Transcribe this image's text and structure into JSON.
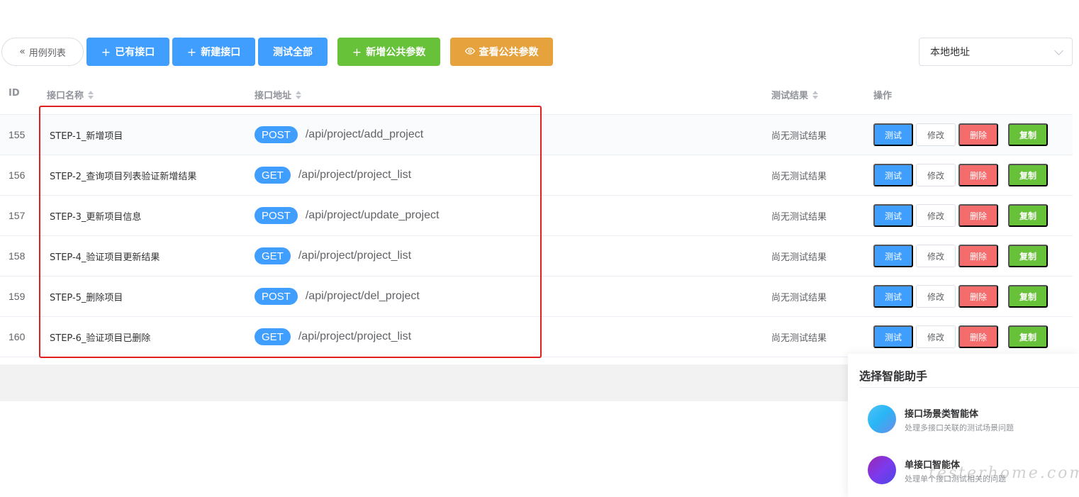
{
  "toolbar": {
    "back_label": "用例列表",
    "existing_label": "已有接口",
    "new_label": "新建接口",
    "test_all_label": "测试全部",
    "add_param_label": "新增公共参数",
    "view_param_label": "查看公共参数",
    "env_select_value": "本地地址"
  },
  "table": {
    "headers": {
      "id": "ID",
      "name": "接口名称",
      "path": "接口地址",
      "result": "测试结果",
      "ops": "操作"
    },
    "rows": [
      {
        "id": "155",
        "name": "STEP-1_新增项目",
        "method": "POST",
        "url": "/api/project/add_project",
        "result": "尚无测试结果"
      },
      {
        "id": "156",
        "name": "STEP-2_查询项目列表验证新增结果",
        "method": "GET",
        "url": "/api/project/project_list",
        "result": "尚无测试结果"
      },
      {
        "id": "157",
        "name": "STEP-3_更新项目信息",
        "method": "POST",
        "url": "/api/project/update_project",
        "result": "尚无测试结果"
      },
      {
        "id": "158",
        "name": "STEP-4_验证项目更新结果",
        "method": "GET",
        "url": "/api/project/project_list",
        "result": "尚无测试结果"
      },
      {
        "id": "159",
        "name": "STEP-5_删除项目",
        "method": "POST",
        "url": "/api/project/del_project",
        "result": "尚无测试结果"
      },
      {
        "id": "160",
        "name": "STEP-6_验证项目已删除",
        "method": "GET",
        "url": "/api/project/project_list",
        "result": "尚无测试结果"
      }
    ],
    "ops": {
      "test": "测试",
      "edit": "修改",
      "delete": "删除",
      "copy": "复制"
    }
  },
  "assistant": {
    "title": "选择智能助手",
    "agents": [
      {
        "name": "接口场景类智能体",
        "desc": "处理多接口关联的测试场景问题"
      },
      {
        "name": "单接口智能体",
        "desc": "处理单个接口测试相关的问题"
      }
    ]
  },
  "watermark": "testerhome.com",
  "colors": {
    "primary": "#409eff",
    "success": "#67c23a",
    "warning": "#e6a23c",
    "danger": "#f56c6c",
    "highlight": "#e02020"
  }
}
